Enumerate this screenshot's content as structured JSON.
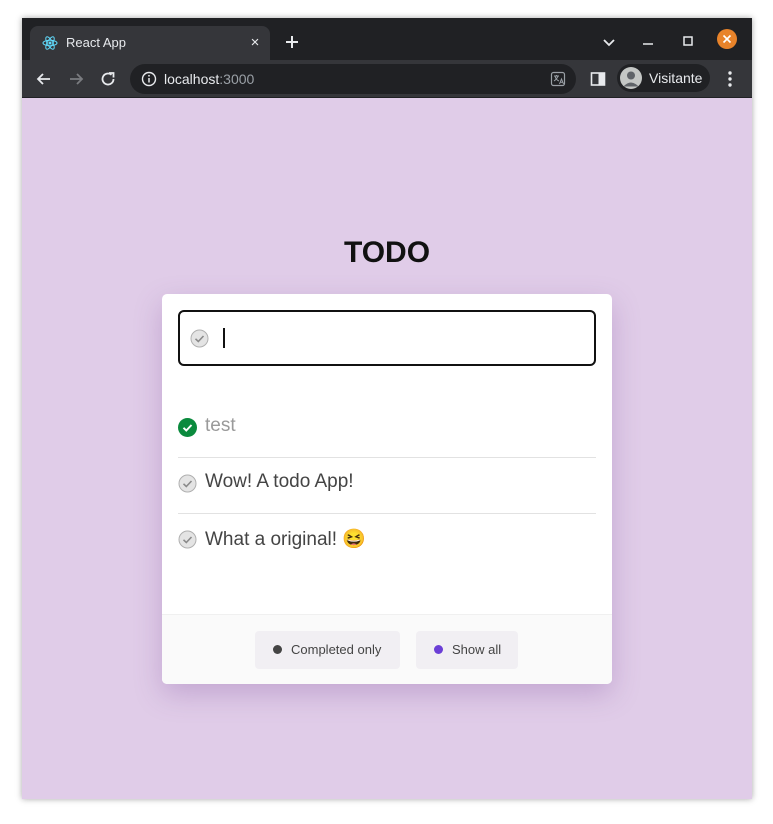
{
  "browser": {
    "tab_title": "React App",
    "tab_close_glyph": "×",
    "url_host": "localhost",
    "url_port": ":3000",
    "profile_name": "Visitante",
    "colors": {
      "frame": "#202124",
      "toolbar": "#35363a",
      "close_window": "#e8832a"
    }
  },
  "page": {
    "title": "TODO",
    "background": "#e0cce8",
    "new_todo_value": "",
    "todos": [
      {
        "text": "test",
        "completed": true
      },
      {
        "text": "Wow! A todo App!",
        "completed": false
      },
      {
        "text": "What a original! 😆",
        "completed": false
      }
    ],
    "filters": [
      {
        "label": "Completed only",
        "dot_color": "#444444"
      },
      {
        "label": "Show all",
        "dot_color": "#6b3fd6"
      }
    ]
  }
}
